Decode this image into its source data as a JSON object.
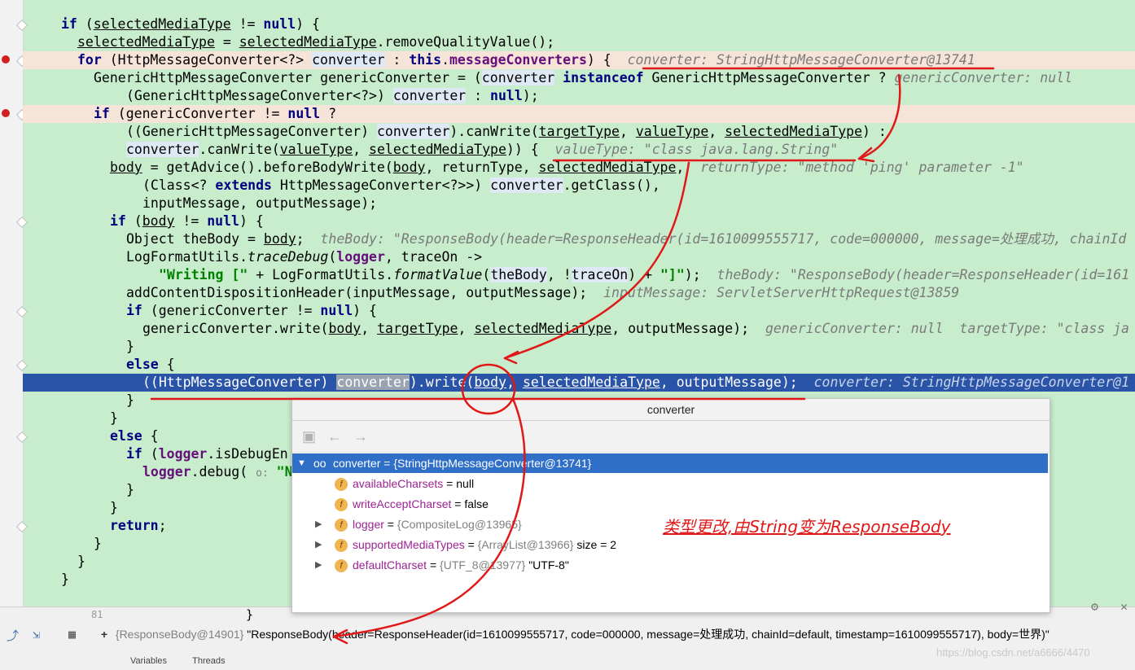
{
  "editor": {
    "lines": [
      {
        "id": "l1",
        "text": [
          "if (",
          {
            "u": "selectedMediaType"
          },
          " != ",
          {
            "kw": "null"
          },
          ") {"
        ]
      },
      {
        "id": "l2",
        "text": [
          {
            "u": "selectedMediaType"
          },
          " = ",
          {
            "u": "selectedMediaType"
          },
          ".removeQualityValue();"
        ]
      }
    ]
  },
  "code": {
    "l01_a": "if",
    "l01_b": " (",
    "l01_c": "selectedMediaType",
    "l01_d": " != ",
    "l01_e": "null",
    "l01_f": ") {",
    "l02_a": "selectedMediaType",
    "l02_b": " = ",
    "l02_c": "selectedMediaType",
    "l02_d": ".removeQualityValue();",
    "l03_a": "for",
    "l03_b": " (HttpMessageConverter<?> ",
    "l03_c": "converter",
    "l03_d": " : ",
    "l03_e": "this",
    "l03_f": ".",
    "l03_g": "messageConverters",
    "l03_h": ") {  ",
    "l03_i": "converter: StringHttpMessageConverter@13741",
    "l04_a": "GenericHttpMessageConverter genericConverter = (",
    "l04_b": "converter",
    "l04_c": " ",
    "l04_d": "instanceof",
    "l04_e": " GenericHttpMessageConverter ? ",
    "l04_f": "genericConverter: null",
    "l05_a": "(GenericHttpMessageConverter<?>) ",
    "l05_b": "converter",
    "l05_c": " : ",
    "l05_d": "null",
    "l05_e": ");",
    "l06_a": "if",
    "l06_b": " (genericConverter != ",
    "l06_c": "null",
    "l06_d": " ?",
    "l07_a": "((GenericHttpMessageConverter) ",
    "l07_b": "converter",
    "l07_c": ").canWrite(",
    "l07_d": "targetType",
    "l07_e": ", ",
    "l07_f": "valueType",
    "l07_g": ", ",
    "l07_h": "selectedMediaType",
    "l07_i": ") :",
    "l08_a": "converter",
    "l08_b": ".canWrite(",
    "l08_c": "valueType",
    "l08_d": ", ",
    "l08_e": "selectedMediaType",
    "l08_f": ")) {  ",
    "l08_g": "valueType: \"class java.lang.String\"",
    "l09_a": "body",
    "l09_b": " = getAdvice().beforeBodyWrite(",
    "l09_c": "body",
    "l09_d": ", returnType, ",
    "l09_e": "selectedMediaType",
    "l09_f": ",  ",
    "l09_g": "returnType: \"method 'ping' parameter -1\"",
    "l10_a": "(Class<? ",
    "l10_b": "extends",
    "l10_c": " HttpMessageConverter<?>>) ",
    "l10_d": "converter",
    "l10_e": ".getClass(),",
    "l11_a": "inputMessage, outputMessage);",
    "l12_a": "if",
    "l12_b": " (",
    "l12_c": "body",
    "l12_d": " != ",
    "l12_e": "null",
    "l12_f": ") {",
    "l13_a": "Object theBody = ",
    "l13_b": "body",
    "l13_c": ";  ",
    "l13_d": "theBody: \"ResponseBody(header=ResponseHeader(id=1610099555717, code=000000, message=处理成功, chainId",
    "l14_a": "LogFormatUtils.",
    "l14_b": "traceDebug",
    "l14_c": "(",
    "l14_d": "logger",
    "l14_e": ", traceOn ->",
    "l15_a": "\"Writing [\"",
    "l15_b": " + LogFormatUtils.",
    "l15_c": "formatValue",
    "l15_d": "(",
    "l15_e": "theBody",
    "l15_f": ", !",
    "l15_g": "traceOn",
    "l15_h": ") + ",
    "l15_i": "\"]\"",
    "l15_j": ");  ",
    "l15_k": "theBody: \"ResponseBody(header=ResponseHeader(id=161",
    "l16_a": "addContentDispositionHeader(inputMessage, outputMessage);  ",
    "l16_b": "inputMessage: ServletServerHttpRequest@13859",
    "l17_a": "if",
    "l17_b": " (genericConverter != ",
    "l17_c": "null",
    "l17_d": ") {",
    "l18_a": "genericConverter.write(",
    "l18_b": "body",
    "l18_c": ", ",
    "l18_d": "targetType",
    "l18_e": ", ",
    "l18_f": "selectedMediaType",
    "l18_g": ", outputMessage);  ",
    "l18_h": "genericConverter: null  targetType: \"class ja",
    "l19_a": "}",
    "l20_a": "else",
    "l20_b": " {",
    "l21_a": "((HttpMessageConverter) ",
    "l21_b": "converter",
    "l21_c": ").write(",
    "l21_d": "body",
    "l21_e": ", ",
    "l21_f": "selectedMediaType",
    "l21_g": ", outputMessage);  ",
    "l21_h": "converter: StringHttpMessageConverter@1",
    "l22_a": "}",
    "l23_a": "}",
    "l24_a": "else",
    "l24_b": " {",
    "l25_a": "if",
    "l25_b": " (",
    "l25_c": "logger",
    "l25_d": ".isDebugEn",
    "l26_a": "logger",
    "l26_b": ".debug( ",
    "l26_c": "o:",
    "l26_d": " \"No",
    "l27_a": "}",
    "l28_a": "}",
    "l29_a": "return",
    "l29_b": ";",
    "l30_a": "}",
    "l31_a": "}",
    "l32_a": "}",
    "l33_a": "81",
    "l34_a": "}"
  },
  "popup": {
    "title": "converter",
    "root": {
      "name": "converter",
      "value": "{StringHttpMessageConverter@13741}"
    },
    "fields": [
      {
        "name": "availableCharsets",
        "eq": " = ",
        "value": "null",
        "extra": ""
      },
      {
        "name": "writeAcceptCharset",
        "eq": " = ",
        "value": "false",
        "extra": ""
      },
      {
        "name": "logger",
        "eq": " = ",
        "value": "{CompositeLog@13965}",
        "extra": ""
      },
      {
        "name": "supportedMediaTypes",
        "eq": " = ",
        "value": "{ArrayList@13966}",
        "extra": "  size = 2"
      },
      {
        "name": "defaultCharset",
        "eq": " = ",
        "value": "{UTF_8@13977}",
        "extra": " \"UTF-8\""
      }
    ]
  },
  "annotation": "类型更改,由String变为ResponseBody",
  "bottom": {
    "value_ref": "{ResponseBody@14901}",
    "value_text": " \"ResponseBody(header=ResponseHeader(id=1610099555717, code=000000, message=处理成功, chainId=default, timestamp=1610099555717), body=世界)\"",
    "tab_variables": "Variables",
    "tab_threads": "Threads"
  },
  "watermark": "https://blog.csdn.net/a6666/4470",
  "colors": {
    "exec_line": "#2a54a8",
    "editor_bg": "#c7edcc",
    "annotation": "#e01818"
  }
}
